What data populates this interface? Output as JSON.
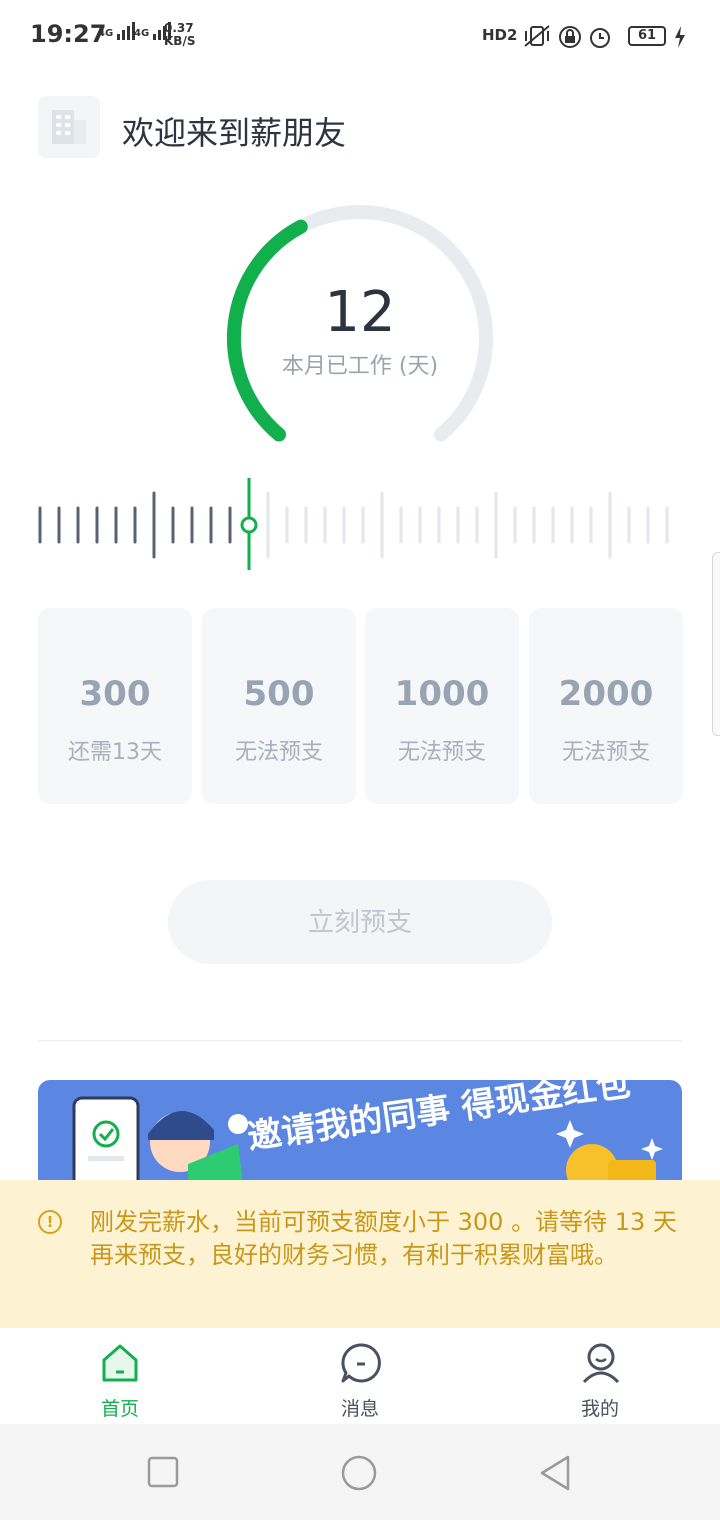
{
  "status_bar": {
    "time": "19:27",
    "signal_1": "4G",
    "signal_2": "4G",
    "net_speed": "0.37",
    "net_unit": "KB/S",
    "hd_badge": "HD2",
    "battery": "61"
  },
  "header": {
    "title": "欢迎来到薪朋友"
  },
  "gauge": {
    "days_worked": "12",
    "label": "本月已工作 (天)",
    "progress_fraction": 0.4,
    "colors": {
      "active": "#12b04c",
      "track": "#e8ecef"
    }
  },
  "ruler": {
    "total_ticks": 34,
    "current_index": 11,
    "colors": {
      "past": "#5a6271",
      "future": "#e3e6ea",
      "marker": "#12b04c"
    }
  },
  "amount_cards": [
    {
      "amount": "300",
      "status": "还需13天"
    },
    {
      "amount": "500",
      "status": "无法预支"
    },
    {
      "amount": "1000",
      "status": "无法预支"
    },
    {
      "amount": "2000",
      "status": "无法预支"
    }
  ],
  "advance_button": {
    "label": "立刻预支"
  },
  "banner": {
    "text": "邀请我的同事 得现金红包"
  },
  "notice": {
    "text": "刚发完薪水，当前可预支额度小于 300 。请等待 13 天再来预支，良好的财务习惯，有利于积累财富哦。",
    "icon": "alert-circle-icon"
  },
  "tabs": [
    {
      "label": "首页",
      "icon": "home-icon",
      "active": true
    },
    {
      "label": "消息",
      "icon": "message-icon",
      "active": false
    },
    {
      "label": "我的",
      "icon": "profile-icon",
      "active": false
    }
  ],
  "accent_color": "#12b04c"
}
